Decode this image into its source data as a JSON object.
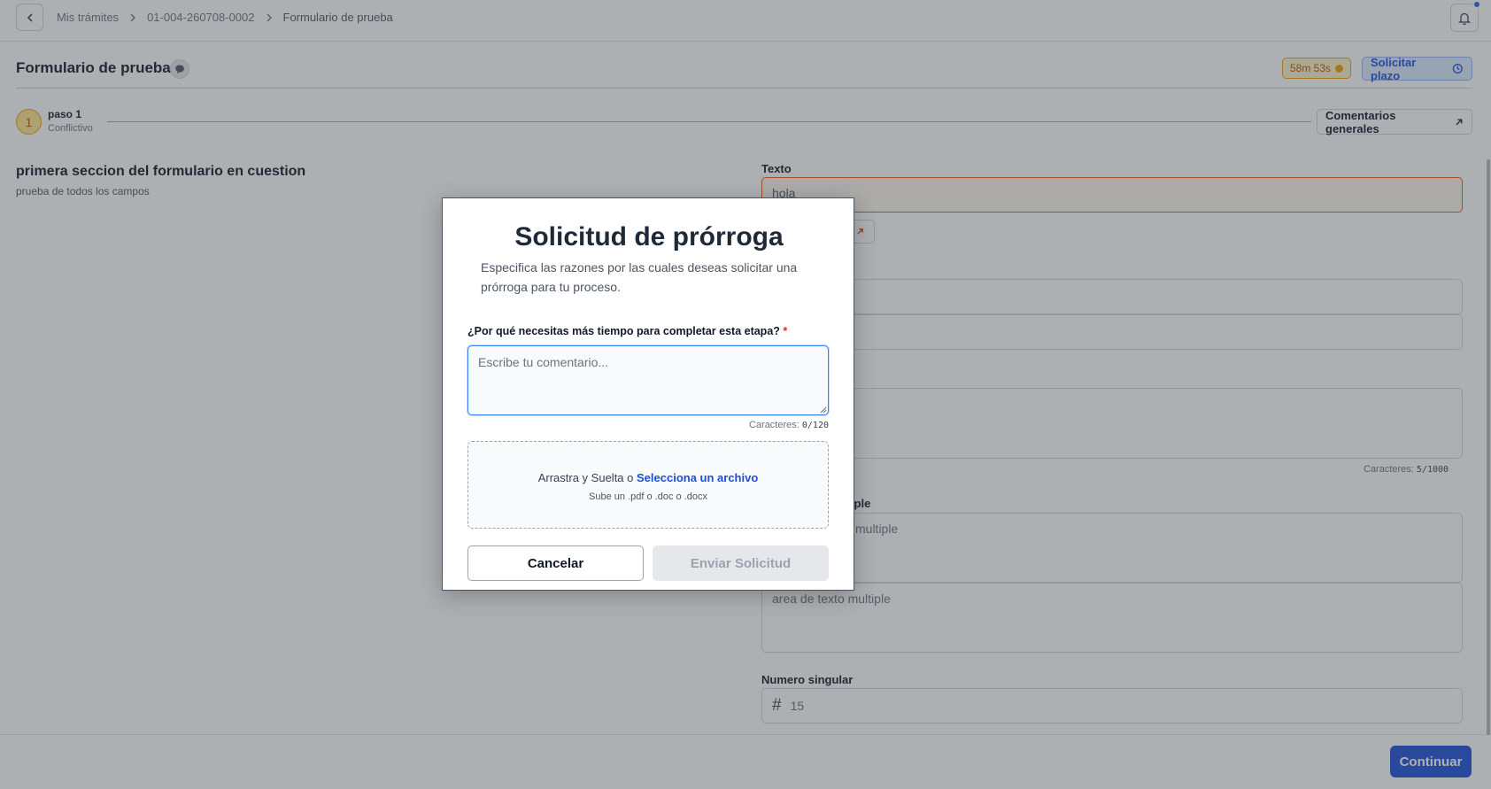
{
  "breadcrumb": [
    "Mis trámites",
    "01-004-260708-0002",
    "Formulario de prueba"
  ],
  "header": {
    "title": "Formulario de prueba",
    "timer": "58m 53s",
    "request_deadline_label": "Solicitar plazo"
  },
  "stepper": {
    "step_number": "1",
    "step_label": "paso 1",
    "step_status": "Conflictivo",
    "general_comments_label": "Comentarios generales"
  },
  "section": {
    "title": "primera seccion del formulario en cuestion",
    "subtitle": "prueba de todos los campos"
  },
  "form": {
    "texto_label": "Texto",
    "texto_value": "hola",
    "char_counter_label": "Caracteres:",
    "char_counter_value": "5/1000",
    "multiple_label_partial": "ltiple",
    "multiple_placeholder_partial": "multiple",
    "multiple_placeholder_2": "area de texto multiple",
    "numero_label": "Numero singular",
    "numero_value": "15"
  },
  "footer": {
    "continue_label": "Continuar"
  },
  "modal": {
    "title": "Solicitud de prórroga",
    "description": "Especifica las razones por las cuales deseas solicitar una prórroga para tu proceso.",
    "question": "¿Por qué necesitas más tiempo para completar esta etapa?",
    "required_mark": "*",
    "comment_placeholder": "Escribe tu comentario...",
    "char_label": "Caracteres:",
    "char_value": "0/120",
    "drop_text": "Arrastra y Suelta o",
    "drop_link": "Selecciona un archivo",
    "drop_hint": "Sube un .pdf o .doc o .docx",
    "cancel_label": "Cancelar",
    "send_label": "Enviar Solicitud"
  },
  "colors": {
    "accent": "#1d4ed8",
    "warning": "#f59e0b",
    "error_border": "#ea580c"
  }
}
